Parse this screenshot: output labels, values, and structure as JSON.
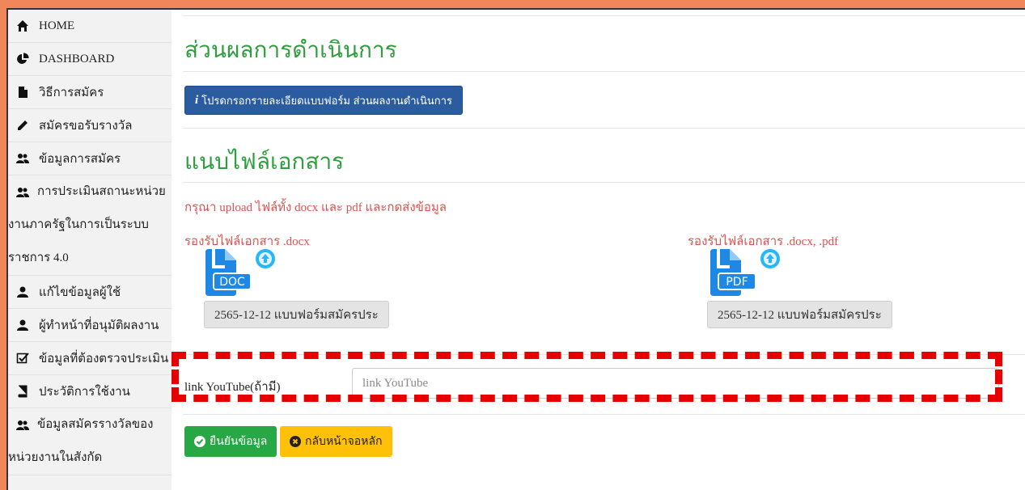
{
  "sidebar": {
    "items": [
      {
        "label": "HOME",
        "icon": "home-icon"
      },
      {
        "label": "DASHBOARD",
        "icon": "pie-chart-icon"
      },
      {
        "label": "วิธีการสมัคร",
        "icon": "file-icon"
      },
      {
        "label": "สมัครขอรับรางวัล",
        "icon": "pencil-icon"
      },
      {
        "label": "ข้อมูลการสมัคร",
        "icon": "users-icon"
      },
      {
        "lines": [
          "การประเมินสถานะหน่วย",
          "งานภาครัฐในการเป็นระบบ",
          "ราชการ 4.0"
        ],
        "icon": "users-icon"
      },
      {
        "label": "แก้ไขข้อมูลผู้ใช้",
        "icon": "user-icon"
      },
      {
        "label": "ผู้ทำหน้าที่อนุมัติผลงาน",
        "icon": "user-icon"
      },
      {
        "label": "ข้อมูลที่ต้องตรวจประเมิน",
        "icon": "checkbox-icon"
      },
      {
        "label": "ประวัติการใช้งาน",
        "icon": "book-icon"
      },
      {
        "lines": [
          "ข้อมูลสมัครรางวัลของ",
          "หน่วยงานในสังกัด"
        ],
        "icon": "users-icon"
      }
    ]
  },
  "main": {
    "section_title": "ส่วนผลการดำเนินการ",
    "info_button": {
      "icon": "info-icon",
      "label": "โปรดกรอกรายละเอียดแบบฟอร์ม ส่วนผลงานดำเนินการ"
    },
    "attach_title": "แนบไฟล์เอกสาร",
    "upload_note": "กรุณา upload ไฟล์ทั้ง docx และ pdf และกดส่งข้อมูล",
    "docx": {
      "label": "รองรับไฟล์เอกสาร .docx",
      "icon_text": "DOC",
      "file_name": "2565-12-12 แบบฟอร์มสมัครประ"
    },
    "pdf": {
      "label": "รองรับไฟล์เอกสาร .docx, .pdf",
      "icon_text": "PDF",
      "file_name": "2565-12-12 แบบฟอร์มสมัครประ"
    },
    "youtube": {
      "label": "link YouTube(ถ้ามี)",
      "placeholder": "link YouTube",
      "value": ""
    },
    "confirm_label": "ยืนยันข้อมูล",
    "back_label": "กลับหน้าจอหลัก"
  },
  "colors": {
    "accent_green": "#2e9e3e",
    "primary_blue": "#2b5c9f",
    "warning_red": "#d9534f",
    "highlight_red": "#e60000",
    "success": "#28a745",
    "warning_yellow": "#ffc107",
    "file_icon_blue": "#1e88e5"
  }
}
